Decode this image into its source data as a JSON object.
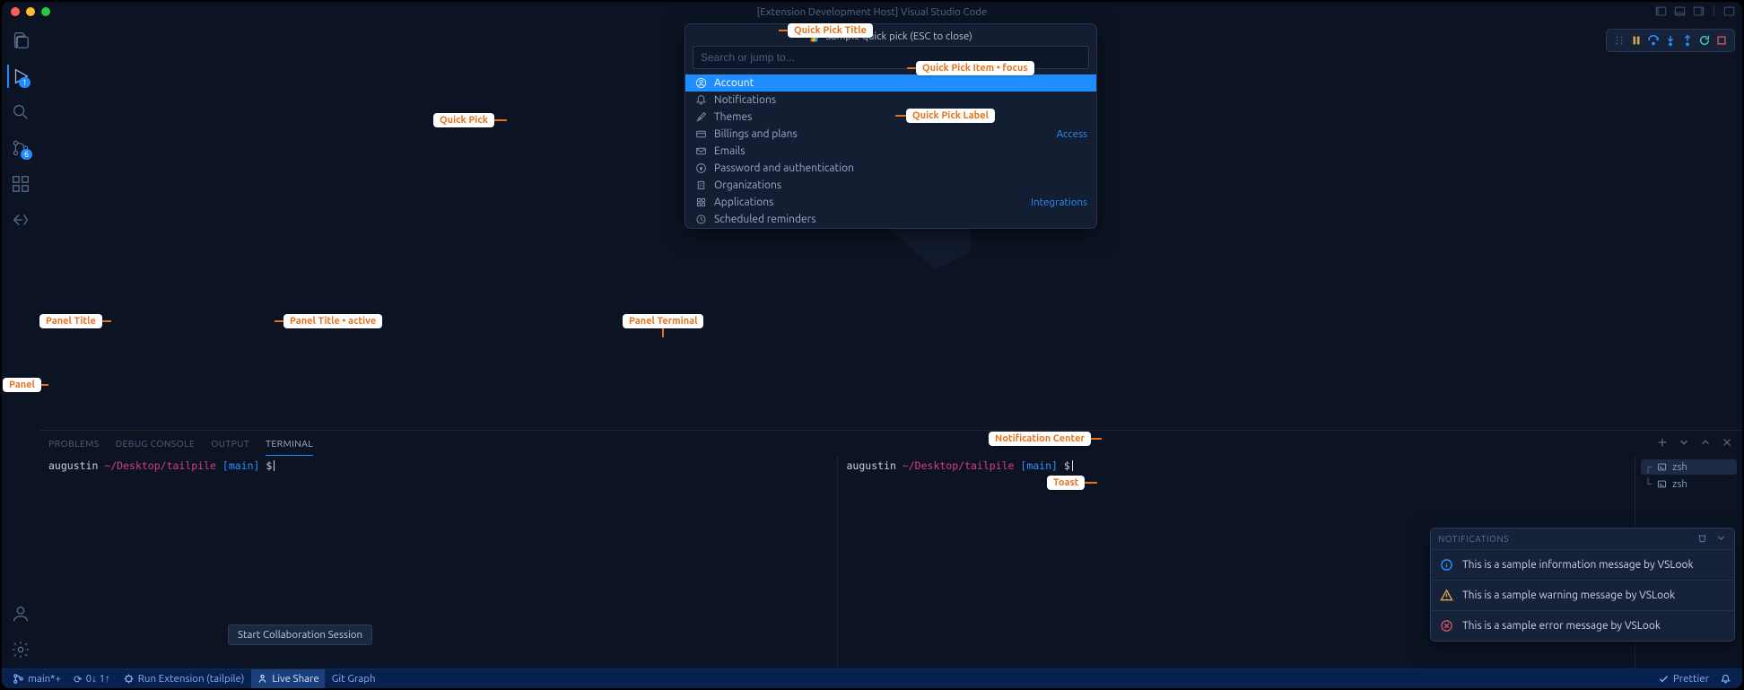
{
  "window_title": "[Extension Development Host] Visual Studio Code",
  "activity_badges": {
    "explorer": "1",
    "scm": "6"
  },
  "quickpick": {
    "title": "Sample quick pick (ESC to close)",
    "placeholder": "Search or jump to...",
    "items": [
      {
        "label": "Account",
        "desc": "",
        "icon": "account"
      },
      {
        "label": "Notifications",
        "desc": "",
        "icon": "bell"
      },
      {
        "label": "Themes",
        "desc": "",
        "icon": "brush"
      },
      {
        "label": "Billings and plans",
        "desc": "Access",
        "icon": "card"
      },
      {
        "label": "Emails",
        "desc": "",
        "icon": "mail"
      },
      {
        "label": "Password and authentication",
        "desc": "",
        "icon": "lock"
      },
      {
        "label": "Organizations",
        "desc": "",
        "icon": "org"
      },
      {
        "label": "Applications",
        "desc": "Integrations",
        "icon": "app"
      },
      {
        "label": "Scheduled reminders",
        "desc": "",
        "icon": "clock"
      }
    ]
  },
  "panel": {
    "tabs": [
      "PROBLEMS",
      "DEBUG CONSOLE",
      "OUTPUT",
      "TERMINAL"
    ],
    "active": "TERMINAL",
    "term_side": [
      "zsh",
      "zsh"
    ],
    "prompt": {
      "user": "augustin",
      "path": "~/Desktop/tailpile",
      "branch": "[main]",
      "symbol": "$"
    }
  },
  "hover_tooltip": "Start Collaboration Session",
  "notifications": {
    "header": "NOTIFICATIONS",
    "items": [
      {
        "kind": "info",
        "text": "This is a sample information message by VSLook"
      },
      {
        "kind": "warn",
        "text": "This is a sample warning message by VSLook"
      },
      {
        "kind": "err",
        "text": "This is a sample error message by VSLook"
      }
    ]
  },
  "statusbar": {
    "branch": "main*+",
    "sync": "0↓ 1↑",
    "run": "Run Extension (tailpile)",
    "liveshare": "Live Share",
    "gitgraph": "Git Graph",
    "prettier": "Prettier"
  },
  "annotations": {
    "quick_pick_title": "Quick Pick Title",
    "quick_pick_item_focus": "Quick Pick Item • focus",
    "quick_pick_label": "Quick Pick Label",
    "quick_pick": "Quick Pick",
    "panel_title": "Panel Title",
    "panel_title_active": "Panel Title • active",
    "panel_terminal": "Panel Terminal",
    "panel": "Panel",
    "notification_center": "Notification Center",
    "toast": "Toast",
    "sync_icon": "⟳"
  }
}
